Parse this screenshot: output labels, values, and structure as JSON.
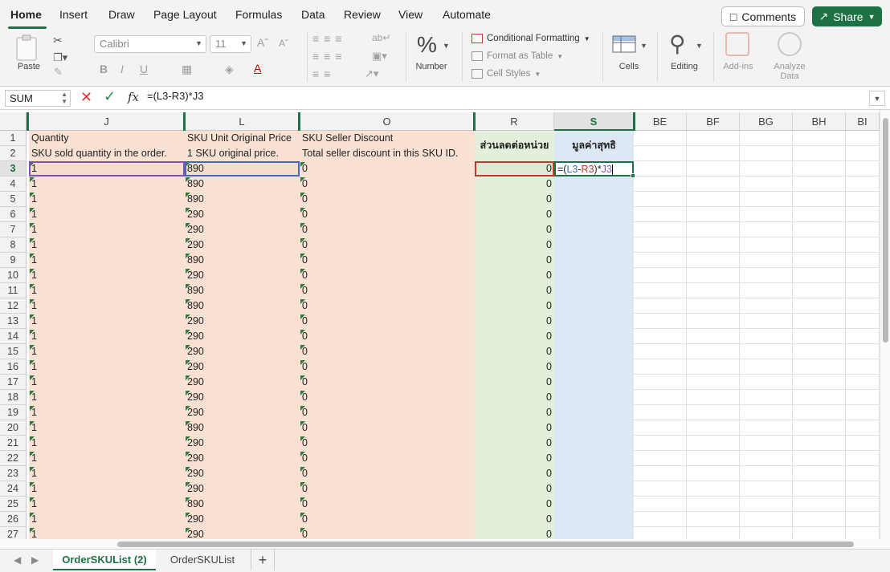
{
  "ribbon": {
    "tabs": [
      "Home",
      "Insert",
      "Draw",
      "Page Layout",
      "Formulas",
      "Data",
      "Review",
      "View",
      "Automate"
    ],
    "comments": "Comments",
    "share": "Share",
    "paste": "Paste",
    "font": "Calibri",
    "size": "11",
    "number": "Number",
    "conditional": "Conditional Formatting",
    "format_table": "Format as Table",
    "cell_styles": "Cell Styles",
    "cells": "Cells",
    "editing": "Editing",
    "addins": "Add-ins",
    "analyze1": "Analyze",
    "analyze2": "Data"
  },
  "formula_bar": {
    "name": "SUM",
    "formula": "=(L3-R3)*J3"
  },
  "columns": [
    "J",
    "L",
    "O",
    "R",
    "S",
    "BE",
    "BF",
    "BG",
    "BH",
    "BI"
  ],
  "headers_row1": {
    "J": "Quantity",
    "L": "SKU Unit Original Price",
    "O": "SKU Seller Discount",
    "R": "ส่วนลดต่อหน่วย",
    "S": "มูลค่าสุทธิ"
  },
  "headers_row2": {
    "J": "SKU sold quantity in the order.",
    "L": "1 SKU original price.",
    "O": "Total seller discount in this SKU ID."
  },
  "editing_cell": {
    "pre": "=(",
    "ref1": "L3",
    "op1": "-",
    "ref2": "R3",
    "op2": ")*",
    "ref3": "J3"
  },
  "rows": [
    {
      "n": "3",
      "J": "1",
      "L": "890",
      "O": "0",
      "R": "0"
    },
    {
      "n": "4",
      "J": "1",
      "L": "890",
      "O": "0",
      "R": "0"
    },
    {
      "n": "5",
      "J": "1",
      "L": "890",
      "O": "0",
      "R": "0"
    },
    {
      "n": "6",
      "J": "1",
      "L": "290",
      "O": "0",
      "R": "0"
    },
    {
      "n": "7",
      "J": "1",
      "L": "290",
      "O": "0",
      "R": "0"
    },
    {
      "n": "8",
      "J": "1",
      "L": "290",
      "O": "0",
      "R": "0"
    },
    {
      "n": "9",
      "J": "1",
      "L": "890",
      "O": "0",
      "R": "0"
    },
    {
      "n": "10",
      "J": "1",
      "L": "290",
      "O": "0",
      "R": "0"
    },
    {
      "n": "11",
      "J": "1",
      "L": "890",
      "O": "0",
      "R": "0"
    },
    {
      "n": "12",
      "J": "1",
      "L": "890",
      "O": "0",
      "R": "0"
    },
    {
      "n": "13",
      "J": "1",
      "L": "290",
      "O": "0",
      "R": "0"
    },
    {
      "n": "14",
      "J": "1",
      "L": "290",
      "O": "0",
      "R": "0"
    },
    {
      "n": "15",
      "J": "1",
      "L": "290",
      "O": "0",
      "R": "0"
    },
    {
      "n": "16",
      "J": "1",
      "L": "290",
      "O": "0",
      "R": "0"
    },
    {
      "n": "17",
      "J": "1",
      "L": "290",
      "O": "0",
      "R": "0"
    },
    {
      "n": "18",
      "J": "1",
      "L": "290",
      "O": "0",
      "R": "0"
    },
    {
      "n": "19",
      "J": "1",
      "L": "290",
      "O": "0",
      "R": "0"
    },
    {
      "n": "20",
      "J": "1",
      "L": "890",
      "O": "0",
      "R": "0"
    },
    {
      "n": "21",
      "J": "1",
      "L": "290",
      "O": "0",
      "R": "0"
    },
    {
      "n": "22",
      "J": "1",
      "L": "290",
      "O": "0",
      "R": "0"
    },
    {
      "n": "23",
      "J": "1",
      "L": "290",
      "O": "0",
      "R": "0"
    },
    {
      "n": "24",
      "J": "1",
      "L": "290",
      "O": "0",
      "R": "0"
    },
    {
      "n": "25",
      "J": "1",
      "L": "890",
      "O": "0",
      "R": "0"
    },
    {
      "n": "26",
      "J": "1",
      "L": "290",
      "O": "0",
      "R": "0"
    },
    {
      "n": "27",
      "J": "1",
      "L": "290",
      "O": "0",
      "R": "0"
    }
  ],
  "sheets": [
    "OrderSKUList (2)",
    "OrderSKUList"
  ],
  "add_sheet": "+",
  "colors": {
    "accent": "#1e7145",
    "fill_orange": "#f9e2d4",
    "fill_green": "#e2efda",
    "fill_blue": "#dde8f4"
  }
}
